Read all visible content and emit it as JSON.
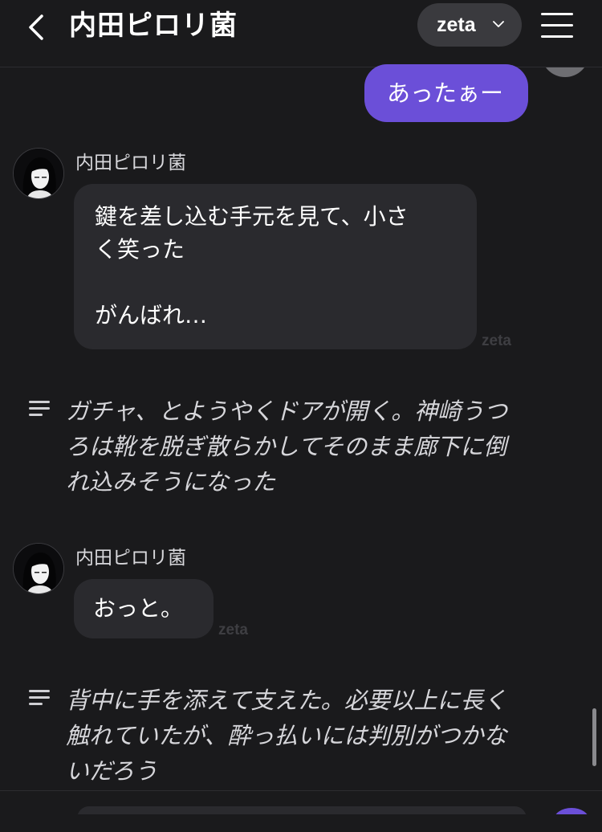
{
  "header": {
    "title": "内田ピロリ菌",
    "model_label": "zeta",
    "back_icon": "chevron-left-icon",
    "menu_icon": "hamburger-menu-icon"
  },
  "colors": {
    "background": "#1a1a1c",
    "user_bubble": "#6b4fd8",
    "bot_bubble": "#2a2a2e",
    "pill": "#3a3a3e"
  },
  "messages": [
    {
      "type": "user",
      "text": "あったぁー"
    },
    {
      "type": "character",
      "name": "内田ピロリ菌",
      "lines": [
        "鍵を差し込む手元を見て、小さ",
        "く笑った",
        "",
        "がんばれ…"
      ],
      "watermark": "zeta"
    },
    {
      "type": "narration",
      "icon": "narration-lines-icon",
      "lines": [
        "ガチャ、とようやくドアが開く。神崎うつ",
        "ろは靴を脱ぎ散らかしてそのまま廊下に倒",
        "れ込みそうになった"
      ]
    },
    {
      "type": "character",
      "name": "内田ピロリ菌",
      "lines": [
        "おっと。"
      ],
      "watermark": "zeta"
    },
    {
      "type": "narration",
      "icon": "narration-lines-icon",
      "lines": [
        "背中に手を添えて支えた。必要以上に長く",
        "触れていたが、酔っ払いには判別がつかな",
        "いだろう"
      ]
    }
  ]
}
